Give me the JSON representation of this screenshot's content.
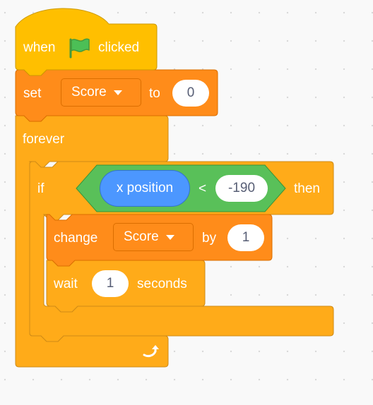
{
  "colors": {
    "events": "#ffbf00",
    "events_stroke": "#cc9900",
    "control": "#ffab19",
    "control_stroke": "#cf8b17",
    "variables": "#ff8c1a",
    "variables_stroke": "#db6e00",
    "operators": "#59c059",
    "operators_stroke": "#389438",
    "motion": "#4c97ff",
    "motion_stroke": "#3373cc"
  },
  "script": {
    "hat_block": {
      "when_label": "when",
      "flag_icon": "green-flag-icon",
      "clicked_label": "clicked"
    },
    "set_block": {
      "label": "set",
      "variable": "Score",
      "to_label": "to",
      "value": "0"
    },
    "forever_block": {
      "label": "forever",
      "loop_icon": "loop-arrow-icon"
    },
    "if_block": {
      "label": "if",
      "then_label": "then",
      "condition": {
        "reporter": "x position",
        "operator": "<",
        "value": "-190"
      }
    },
    "change_block": {
      "label": "change",
      "variable": "Score",
      "by_label": "by",
      "value": "1"
    },
    "wait_block": {
      "label": "wait",
      "value": "1",
      "seconds_label": "seconds"
    }
  }
}
